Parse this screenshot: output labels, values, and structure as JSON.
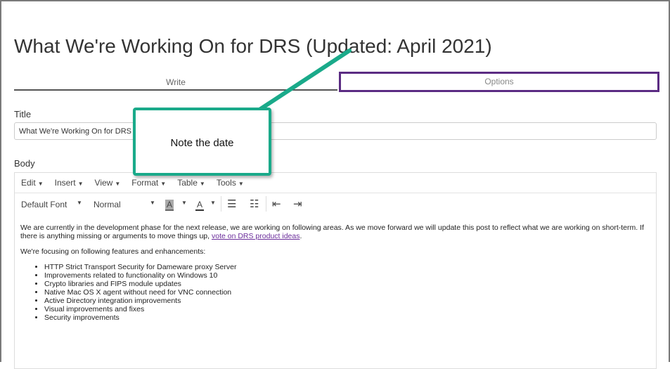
{
  "page_title": "What We're Working On for DRS (Updated: April 2021)",
  "tabs": [
    {
      "label": "Write"
    },
    {
      "label": "Options"
    }
  ],
  "title_label": "Title",
  "title_value": "What We're Working On for DRS (Updated: April 2021)",
  "body_label": "Body",
  "menu": [
    "Edit",
    "Insert",
    "View",
    "Format",
    "Table",
    "Tools"
  ],
  "toolbar": {
    "font": "Default Font",
    "size": "Normal",
    "bg_color_letter": "A",
    "text_color_letter": "A"
  },
  "body": {
    "para1": "We are currently in the development phase for the next release, we are working on following areas. As we move forward we will update this post to reflect what we are working on short-term.  If there is anything missing or arguments to move things up, ",
    "link": "vote on DRS product ideas",
    "para1_end": ".",
    "para2": "We're focusing on following features and enhancements:",
    "items": [
      "HTTP Strict Transport Security for Dameware proxy Server",
      "Improvements related to functionality on Windows 10",
      "Crypto libraries and FIPS module updates",
      "Native Mac OS X agent without need for VNC connection",
      "Active Directory integration improvements",
      "Visual improvements and fixes",
      "Security improvements"
    ]
  },
  "callout": "Note the date",
  "colors": {
    "callout": "#1aaa8a",
    "highlight": "#5b2c83",
    "link": "#6a2c9a"
  }
}
